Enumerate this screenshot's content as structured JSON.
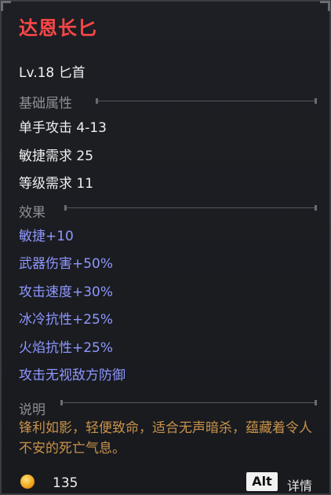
{
  "item": {
    "name": "达恩长匕",
    "level_type": "Lv.18 匕首"
  },
  "sections": {
    "basic": "基础属性",
    "effects": "效果",
    "description": "说明"
  },
  "stats": [
    "单手攻击 4-13",
    "敏捷需求 25",
    "等级需求 11"
  ],
  "effects": [
    "敏捷+10",
    "武器伤害+50%",
    "攻击速度+30%",
    "冰冷抗性+25%",
    "火焰抗性+25%",
    "攻击无视敌方防御"
  ],
  "description": "锋利如影，轻便致命，适合无声暗杀，蕴藏着令人不安的死亡气息。",
  "footer": {
    "gold": "135",
    "alt_key": "Alt",
    "detail_label": "详情"
  },
  "colors": {
    "title": "#ff4747",
    "effect": "#8f97ff",
    "description": "#c8924a",
    "icon": "gold-coin-icon"
  }
}
